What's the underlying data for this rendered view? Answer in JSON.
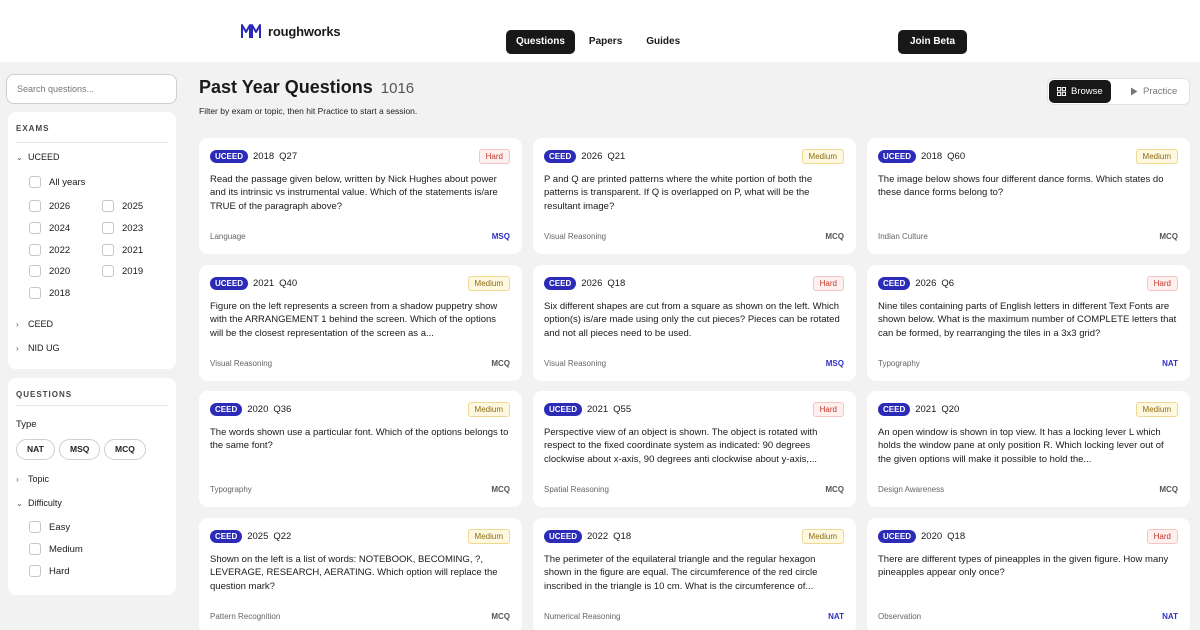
{
  "brand": {
    "name": "roughworks",
    "color": "#2b2bb8"
  },
  "nav": [
    {
      "label": "Questions",
      "active": true
    },
    {
      "label": "Papers",
      "active": false
    },
    {
      "label": "Guides",
      "active": false
    }
  ],
  "cta": {
    "label": "Join Beta"
  },
  "sidebar": {
    "search_placeholder": "Search questions...",
    "exams": {
      "title": "EXAMS",
      "groups": [
        {
          "label": "UCEED",
          "expanded": true
        },
        {
          "label": "CEED",
          "expanded": false
        },
        {
          "label": "NID UG",
          "expanded": false
        }
      ],
      "uceed_years": {
        "all": "All years",
        "left": [
          "2026",
          "2024",
          "2022",
          "2020",
          "2018"
        ],
        "right": [
          "2025",
          "2023",
          "2021",
          "2019"
        ]
      }
    },
    "questions": {
      "title": "QUESTIONS",
      "type_label": "Type",
      "types": [
        "NAT",
        "MSQ",
        "MCQ"
      ],
      "topic_label": "Topic",
      "difficulty_label": "Difficulty",
      "difficulties": [
        "Easy",
        "Medium",
        "Hard"
      ]
    }
  },
  "main": {
    "title": "Past Year Questions",
    "count": "1016",
    "subtitle": "Filter by exam or topic, then hit Practice to start a session.",
    "view_toggle": {
      "browse": "Browse",
      "practice": "Practice",
      "active": "browse"
    }
  },
  "colors": {
    "exam_badge": "#2b2bb8",
    "hard": "#c0392b",
    "medium": "#8a6d12",
    "type_highlight": "#3030c0"
  },
  "cards": [
    {
      "exam": "UCEED",
      "year": "2018",
      "q": "Q27",
      "difficulty": "Hard",
      "text": "Read the passage given below, written by Nick Hughes about power and its intrinsic vs instrumental value. Which of the statements is/are TRUE of the paragraph above?",
      "topic": "Language",
      "type": "MSQ"
    },
    {
      "exam": "CEED",
      "year": "2026",
      "q": "Q21",
      "difficulty": "Medium",
      "text": "P and Q are printed patterns where the white portion of both the patterns is transparent. If Q is overlapped on P, what will be the resultant image?",
      "topic": "Visual Reasoning",
      "type": "MCQ"
    },
    {
      "exam": "UCEED",
      "year": "2018",
      "q": "Q60",
      "difficulty": "Medium",
      "text": "The image below shows four different dance forms. Which states do these dance forms belong to?",
      "topic": "Indian Culture",
      "type": "MCQ"
    },
    {
      "exam": "UCEED",
      "year": "2021",
      "q": "Q40",
      "difficulty": "Medium",
      "text": "Figure on the left represents a screen from a shadow puppetry show with the ARRANGEMENT 1 behind the screen. Which of the options will be the closest representation of the screen as a...",
      "topic": "Visual Reasoning",
      "type": "MCQ"
    },
    {
      "exam": "CEED",
      "year": "2026",
      "q": "Q18",
      "difficulty": "Hard",
      "text": "Six different shapes are cut from a square as shown on the left. Which option(s) is/are made using only the cut pieces? Pieces can be rotated and not all pieces need to be used.",
      "topic": "Visual Reasoning",
      "type": "MSQ"
    },
    {
      "exam": "CEED",
      "year": "2026",
      "q": "Q6",
      "difficulty": "Hard",
      "text": "Nine tiles containing parts of English letters in different Text Fonts are shown below. What is the maximum number of COMPLETE letters that can be formed, by rearranging the tiles in a 3x3 grid?",
      "topic": "Typography",
      "type": "NAT"
    },
    {
      "exam": "CEED",
      "year": "2020",
      "q": "Q36",
      "difficulty": "Medium",
      "text": "The words shown use a particular font. Which of the options belongs to the same font?",
      "topic": "Typography",
      "type": "MCQ"
    },
    {
      "exam": "UCEED",
      "year": "2021",
      "q": "Q55",
      "difficulty": "Hard",
      "text": "Perspective view of an object is shown. The object is rotated with respect to the fixed coordinate system as indicated: 90 degrees clockwise about x-axis, 90 degrees anti clockwise about y-axis,...",
      "topic": "Spatial Reasoning",
      "type": "MCQ"
    },
    {
      "exam": "CEED",
      "year": "2021",
      "q": "Q20",
      "difficulty": "Medium",
      "text": "An open window is shown in top view. It has a locking lever L which holds the window pane at only position R. Which locking lever out of the given options will make it possible to hold the...",
      "topic": "Design Awareness",
      "type": "MCQ"
    },
    {
      "exam": "CEED",
      "year": "2025",
      "q": "Q22",
      "difficulty": "Medium",
      "text": "Shown on the left is a list of words: NOTEBOOK, BECOMING, ?, LEVERAGE, RESEARCH, AERATING. Which option will replace the question mark?",
      "topic": "Pattern Recognition",
      "type": "MCQ"
    },
    {
      "exam": "UCEED",
      "year": "2022",
      "q": "Q18",
      "difficulty": "Medium",
      "text": "The perimeter of the equilateral triangle and the regular hexagon shown in the figure are equal. The circumference of the red circle inscribed in the triangle is 10 cm. What is the circumference of...",
      "topic": "Numerical Reasoning",
      "type": "NAT"
    },
    {
      "exam": "UCEED",
      "year": "2020",
      "q": "Q18",
      "difficulty": "Hard",
      "text": "There are different types of pineapples in the given figure. How many pineapples appear only once?",
      "topic": "Observation",
      "type": "NAT"
    }
  ]
}
